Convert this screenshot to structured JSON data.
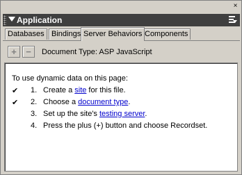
{
  "panel": {
    "close_glyph": "×",
    "title": "Application",
    "caret_icon": "triangle-down-icon",
    "options_icon": "options-menu-icon"
  },
  "tabs": [
    {
      "label": "Databases",
      "active": false
    },
    {
      "label": "Bindings",
      "active": false
    },
    {
      "label": "Server Behaviors",
      "active": true
    },
    {
      "label": "Components",
      "active": false
    }
  ],
  "toolbar": {
    "add_glyph": "+",
    "remove_glyph": "−",
    "doc_type": "Document Type: ASP JavaScript"
  },
  "content": {
    "intro": "To use dynamic data on this page:",
    "steps": [
      {
        "checked": true,
        "num": "1.",
        "pre": "Create a ",
        "link": "site",
        "post": " for this file."
      },
      {
        "checked": true,
        "num": "2.",
        "pre": "Choose a ",
        "link": "document type",
        "post": "."
      },
      {
        "checked": false,
        "num": "3.",
        "pre": "Set up the site's ",
        "link": "testing server",
        "post": "."
      },
      {
        "checked": false,
        "num": "4.",
        "pre": "Press the plus (+) button and choose Recordset.",
        "link": "",
        "post": ""
      }
    ],
    "check_glyph": "✔"
  }
}
